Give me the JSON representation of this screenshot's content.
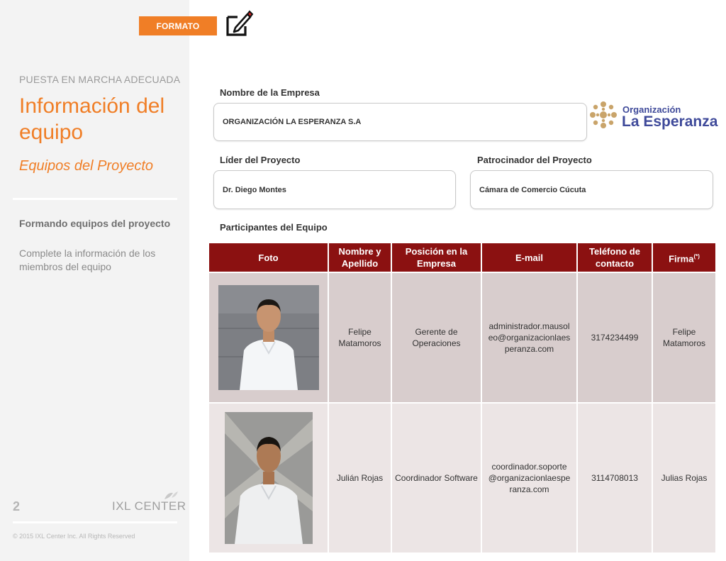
{
  "header": {
    "badge": "FORMATO",
    "edit_icon": "edit-icon"
  },
  "sidebar": {
    "section_label": "PUESTA EN MARCHA ADECUADA",
    "title": "Información del equipo",
    "subtitle": "Equipos del Proyecto",
    "heading": "Formando equipos del proyecto",
    "description": "Complete la información de los miembros del equipo",
    "page_number": "2",
    "brand": "IXL CENTER",
    "copyright": "© 2015 IXL Center Inc. All Rights Reserved"
  },
  "form": {
    "company_label": "Nombre de la Empresa",
    "company_value": "ORGANIZACIÓN LA ESPERANZA S.A",
    "leader_label": "Líder del Proyecto",
    "leader_value": "Dr. Diego Montes",
    "sponsor_label": "Patrocinador del Proyecto",
    "sponsor_value": "Cámara de Comercio Cúcuta",
    "participants_label": "Participantes del Equipo"
  },
  "logo": {
    "line1": "Organización",
    "line2": "La Esperanza",
    "color": "#3f4a9a",
    "mark_color": "#c9a46a"
  },
  "table": {
    "headers": [
      "Foto",
      "Nombre y Apellido",
      "Posición en la Empresa",
      "E-mail",
      "Teléfono de contacto",
      "Firma"
    ],
    "firma_sup": "(*)",
    "rows": [
      {
        "name": "Felipe Matamoros",
        "position": "Gerente de Operaciones",
        "email": "administrador.mausoleo@organizacionlaesperanza.com",
        "phone": "3174234499",
        "signature": "Felipe Matamoros"
      },
      {
        "name": "Julián Rojas",
        "position": "Coordinador Software",
        "email": "coordinador.soporte@organizacionlaesperanza.com",
        "phone": "3114708013",
        "signature": "Julias Rojas"
      }
    ]
  },
  "colors": {
    "accent": "#f07e26",
    "table_header": "#8b1111",
    "row1_bg": "#d8cdcd",
    "row2_bg": "#ece5e5"
  }
}
